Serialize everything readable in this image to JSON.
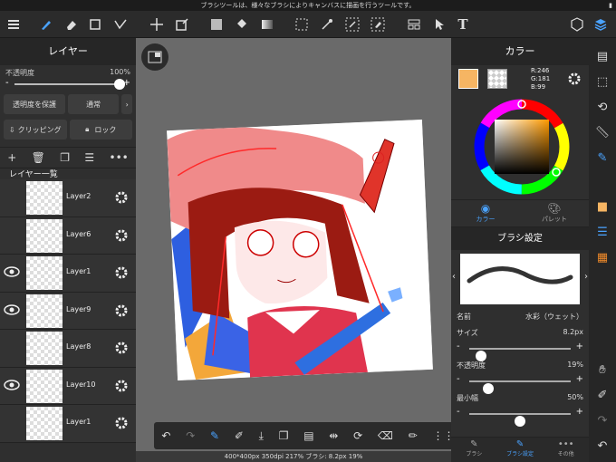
{
  "status": {
    "message": "ブラシツールは、様々なブラシによりキャンバスに描画を行うツールです。",
    "battery": "■"
  },
  "toolbar": {
    "menu_icon": "hamburger-icon",
    "text_tool": "T"
  },
  "layer_panel": {
    "title": "レイヤー",
    "opacity_label": "不透明度",
    "opacity_value": "100%",
    "opacity_fraction": 1.0,
    "minus": "-",
    "plus": "+",
    "protect_alpha": "透明度を保護",
    "blend_mode": "通常",
    "clipping": "クリッピング",
    "lock": "ロック",
    "list_title": "レイヤー一覧",
    "layers": [
      {
        "name": "Layer2",
        "visible": false
      },
      {
        "name": "Layer6",
        "visible": false
      },
      {
        "name": "Layer1",
        "visible": true
      },
      {
        "name": "Layer9",
        "visible": true
      },
      {
        "name": "Layer8",
        "visible": false
      },
      {
        "name": "Layer10",
        "visible": true
      },
      {
        "name": "Layer1",
        "visible": false
      }
    ]
  },
  "canvas": {
    "info": "400*400px 350dpi 217% ブラシ: 8.2px 19%"
  },
  "color_panel": {
    "title": "カラー",
    "main_color": "#F6B563",
    "r": "R:246",
    "g": "G:181",
    "b": "B:99",
    "tab_color": "カラー",
    "tab_palette": "パレット"
  },
  "brush_panel": {
    "title": "ブラシ設定",
    "name_label": "名前",
    "name_value": "水彩（ウェット）",
    "size_label": "サイズ",
    "size_value": "8.2px",
    "size_fraction": 0.12,
    "opacity_label": "不透明度",
    "opacity_value": "19%",
    "opacity_fraction": 0.19,
    "min_width_label": "最小幅",
    "min_width_value": "50%",
    "min_width_fraction": 0.5,
    "minus": "-",
    "plus": "+",
    "tab_brush": "ブラシ",
    "tab_brush_settings": "ブラシ設定",
    "tab_other": "その他"
  },
  "accent": "#4aa3ff"
}
